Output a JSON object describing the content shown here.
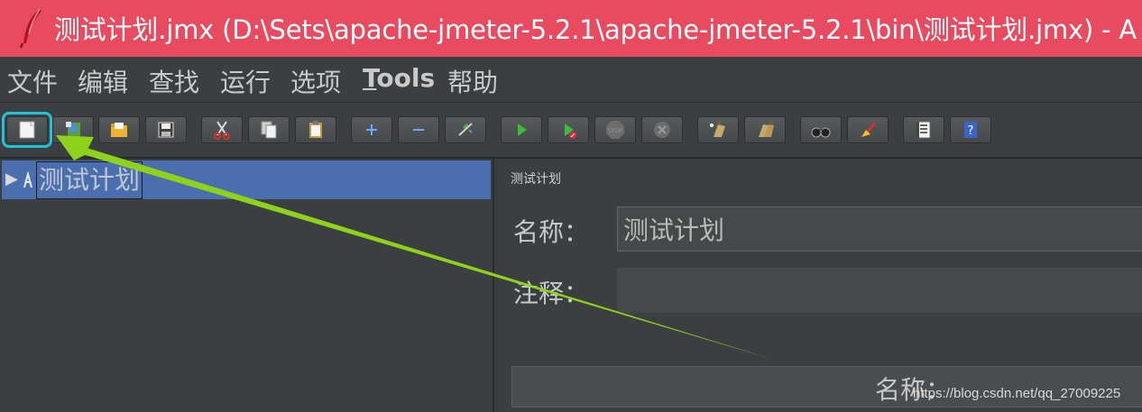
{
  "window": {
    "title": "测试计划.jmx (D:\\Sets\\apache-jmeter-5.2.1\\apache-jmeter-5.2.1\\bin\\测试计划.jmx) - A"
  },
  "menu": {
    "file": "文件",
    "edit": "编辑",
    "search": "查找",
    "run": "运行",
    "options": "选项",
    "tools_first": "T",
    "tools_rest": "ools",
    "help": "帮助"
  },
  "tree": {
    "node_label": "测试计划"
  },
  "panel": {
    "title": "测试计划",
    "name_label": "名称：",
    "name_value": "测试计划",
    "comment_label": "注释：",
    "comment_value": "",
    "table_header": "名称："
  },
  "watermark": "https://blog.csdn.net/qq_27009225",
  "colors": {
    "titlebar": "#e84a5f",
    "background": "#3c3f41",
    "selection": "#4b6eaf",
    "highlight_box": "#1fc5d6",
    "arrow": "#8fd21c"
  }
}
